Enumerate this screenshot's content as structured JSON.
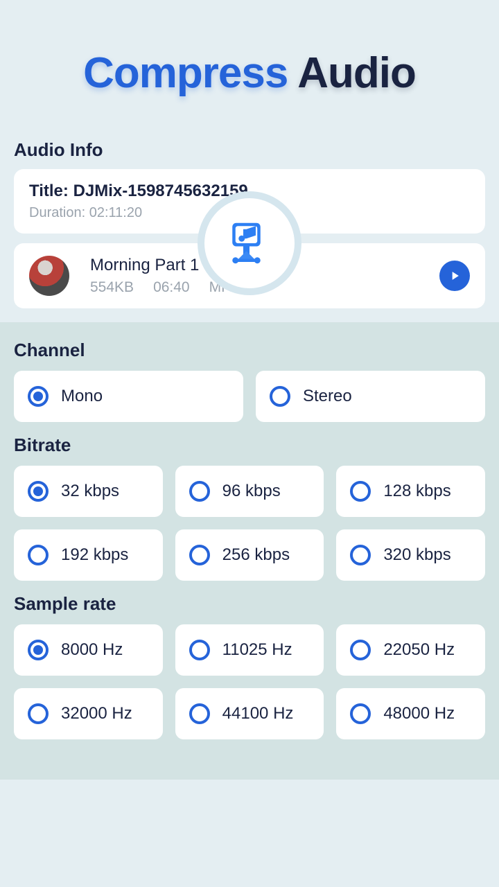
{
  "header": {
    "title_part1": "Compress",
    "title_part2": "Audio"
  },
  "audio_info": {
    "section_label": "Audio Info",
    "title_label": "Title: ",
    "title_value": "DJMix-1598745632159",
    "duration_label": "Duration: ",
    "duration_value": "02:11:20",
    "track": {
      "name": "Morning Part 1",
      "size": "554KB",
      "length": "06:40",
      "format": "MP3"
    }
  },
  "channel": {
    "label": "Channel",
    "options": [
      "Mono",
      "Stereo"
    ],
    "selected": "Mono"
  },
  "bitrate": {
    "label": "Bitrate",
    "options": [
      "32 kbps",
      "96 kbps",
      "128 kbps",
      "192 kbps",
      "256 kbps",
      "320 kbps"
    ],
    "selected": "32 kbps"
  },
  "sample_rate": {
    "label": "Sample rate",
    "options": [
      "8000 Hz",
      "11025 Hz",
      "22050 Hz",
      "32000 Hz",
      "44100 Hz",
      "48000 Hz"
    ],
    "selected": "8000 Hz"
  }
}
